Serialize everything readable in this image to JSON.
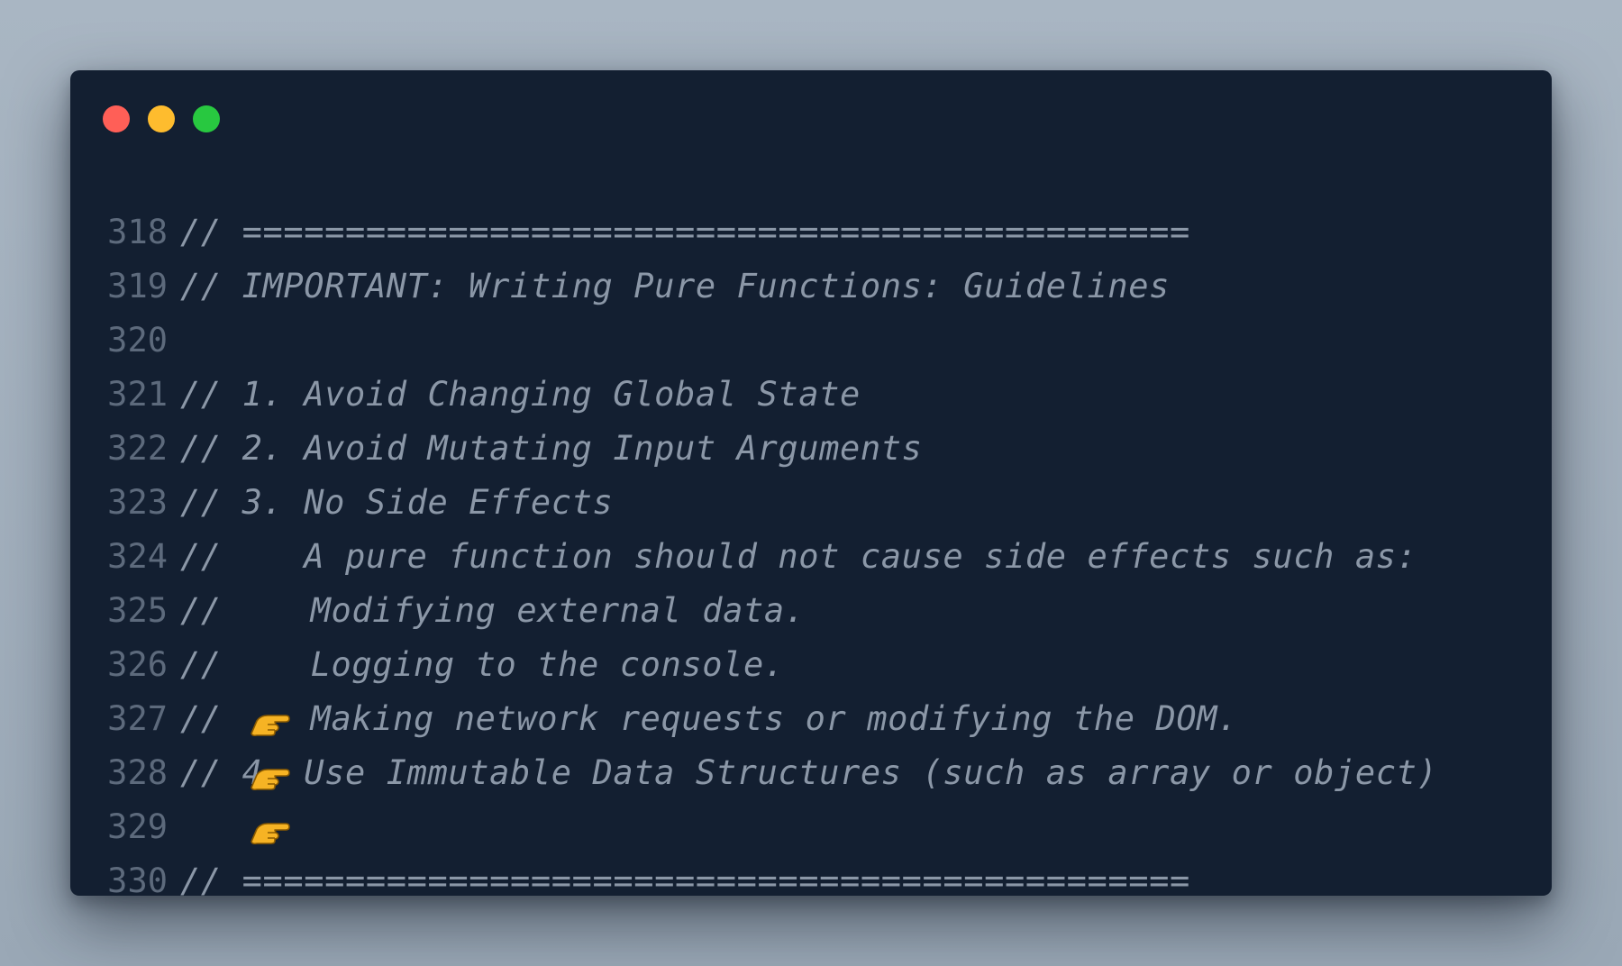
{
  "window": {
    "controls": [
      "close",
      "minimize",
      "maximize"
    ]
  },
  "lines": [
    {
      "num": "318",
      "text": "// ==============================================",
      "pointer": false
    },
    {
      "num": "319",
      "text": "// IMPORTANT: Writing Pure Functions: Guidelines",
      "pointer": false
    },
    {
      "num": "320",
      "text": "",
      "pointer": false
    },
    {
      "num": "321",
      "text": "// 1. Avoid Changing Global State",
      "pointer": false
    },
    {
      "num": "322",
      "text": "// 2. Avoid Mutating Input Arguments",
      "pointer": false
    },
    {
      "num": "323",
      "text": "// 3. No Side Effects",
      "pointer": false
    },
    {
      "num": "324",
      "text": "//    A pure function should not cause side effects such as:",
      "pointer": false
    },
    {
      "num": "325",
      "prefix": "// ",
      "text": "Modifying external data.",
      "pointer": true
    },
    {
      "num": "326",
      "prefix": "// ",
      "text": "Logging to the console.",
      "pointer": true
    },
    {
      "num": "327",
      "prefix": "// ",
      "text": "Making network requests or modifying the DOM.",
      "pointer": true
    },
    {
      "num": "328",
      "text": "// 4. Use Immutable Data Structures (such as array or object)",
      "pointer": false
    },
    {
      "num": "329",
      "text": "",
      "pointer": false
    },
    {
      "num": "330",
      "text": "// ==============================================",
      "pointer": false
    }
  ],
  "colors": {
    "background": "#131f31",
    "line_number": "#5d6a7c",
    "comment": "#8b97a7",
    "close": "#ff5f57",
    "minimize": "#febc2e",
    "maximize": "#28c840"
  },
  "icons": {
    "bullet": "pointing-hand-icon"
  }
}
